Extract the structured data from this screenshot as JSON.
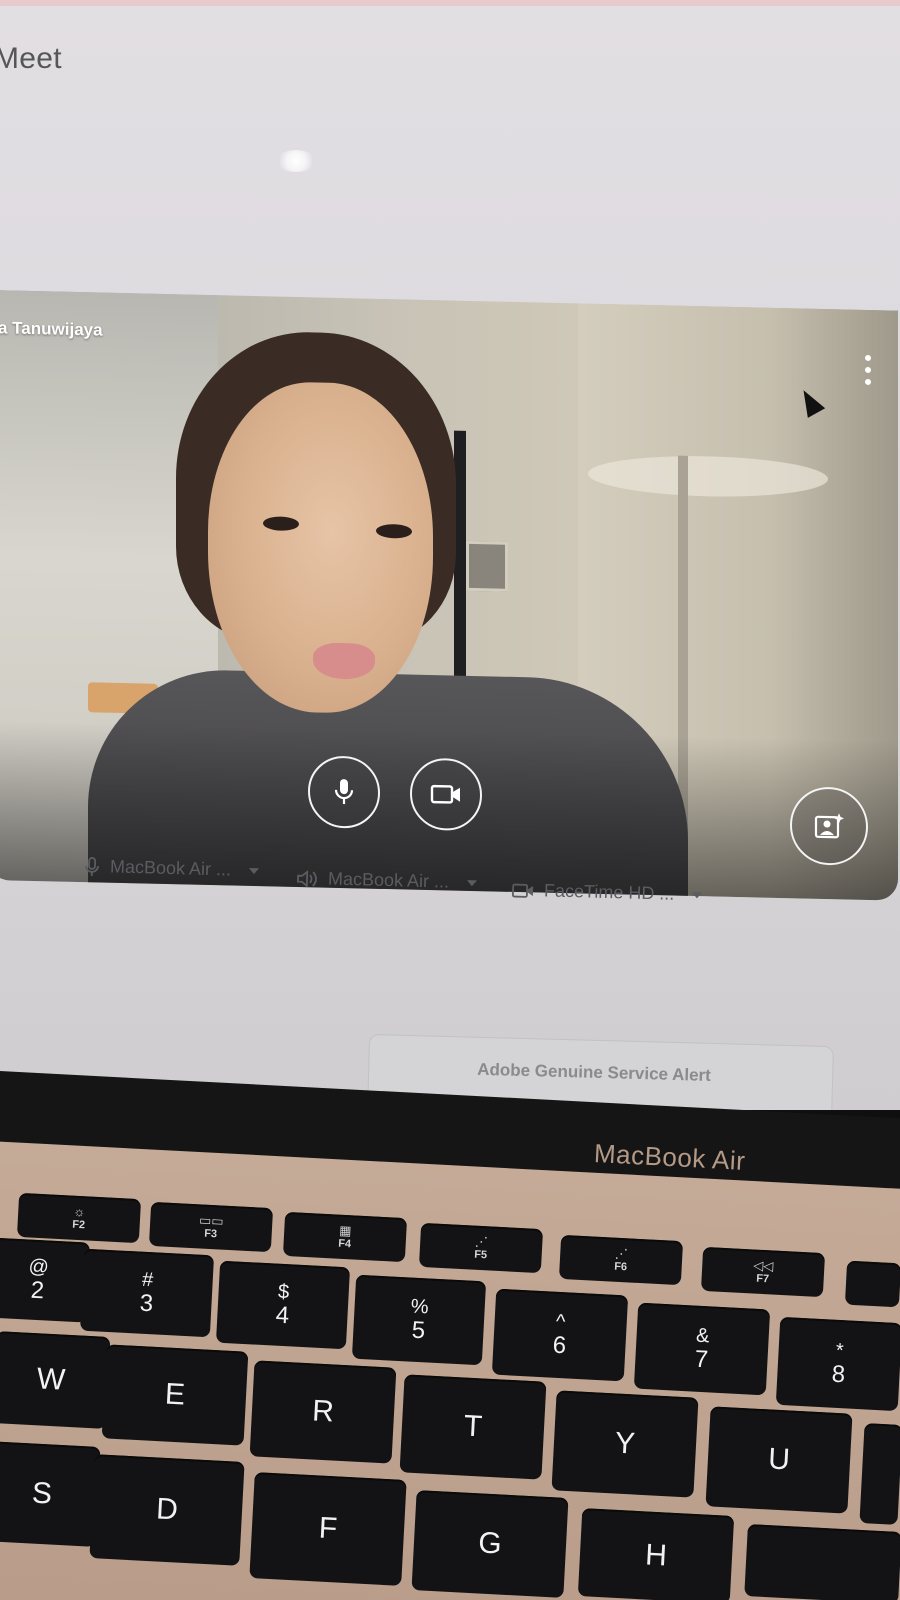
{
  "app": {
    "title": "Meet"
  },
  "preview": {
    "participant_name": "a Tanuwijaya",
    "controls": {
      "mic": "microphone",
      "camera": "camera",
      "effects": "visual effects"
    }
  },
  "devices": {
    "microphone": "MacBook Air ...",
    "speaker": "MacBook Air ...",
    "camera": "FaceTime HD ..."
  },
  "notification": {
    "text": "Adobe Genuine Service Alert"
  },
  "laptop": {
    "brand": "MacBook Air"
  },
  "keyboard": {
    "fn_row": [
      {
        "label": "F2",
        "glyph": "☼"
      },
      {
        "label": "F3",
        "glyph": "▭▭"
      },
      {
        "label": "F4",
        "glyph": "▦"
      },
      {
        "label": "F5",
        "glyph": "⋰"
      },
      {
        "label": "F6",
        "glyph": "⋰"
      },
      {
        "label": "F7",
        "glyph": "◁◁"
      }
    ],
    "number_row": [
      {
        "shift": "@",
        "key": "2"
      },
      {
        "shift": "#",
        "key": "3"
      },
      {
        "shift": "$",
        "key": "4"
      },
      {
        "shift": "%",
        "key": "5"
      },
      {
        "shift": "^",
        "key": "6"
      },
      {
        "shift": "&",
        "key": "7"
      },
      {
        "shift": "*",
        "key": "8"
      }
    ],
    "letter_row_1": [
      "W",
      "E",
      "R",
      "T",
      "Y",
      "U"
    ],
    "letter_row_2": [
      "S",
      "D",
      "F",
      "G",
      "H"
    ]
  }
}
